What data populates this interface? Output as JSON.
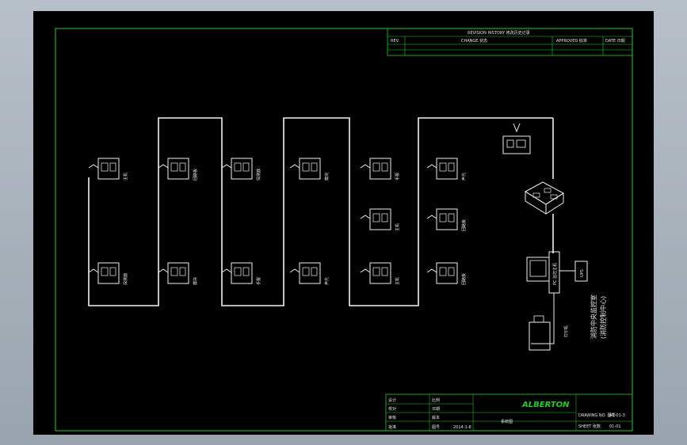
{
  "revision_table": {
    "header": "REVISION HISTORY 修改历史记录",
    "columns": [
      "REV.",
      "CHANGE 状态",
      "APPROVED 批准",
      "DATE 日期"
    ]
  },
  "diagram": {
    "pc_label": "PC 监控主机",
    "ups_label": "UPS",
    "printer_label": "打印机",
    "center_label_line1": "消防中央监控室",
    "center_label_line2": "(消防控制中心)",
    "device_labels": [
      "主机",
      "回路板",
      "探测器",
      "模块",
      "手报",
      "声光"
    ]
  },
  "title_block": {
    "logo_text": "ALBERTON",
    "drawing_title": "系统图",
    "date": "2014-1-8",
    "left_labels": [
      "设计",
      "校对",
      "审核",
      "批准"
    ],
    "mid_labels": [
      "比例",
      "日期",
      "版本",
      "图号"
    ],
    "right_labels": [
      "DRAWING NO. 图号",
      "SHEET 张数"
    ],
    "right_values": [
      "A1-01-3",
      "01-01"
    ]
  }
}
